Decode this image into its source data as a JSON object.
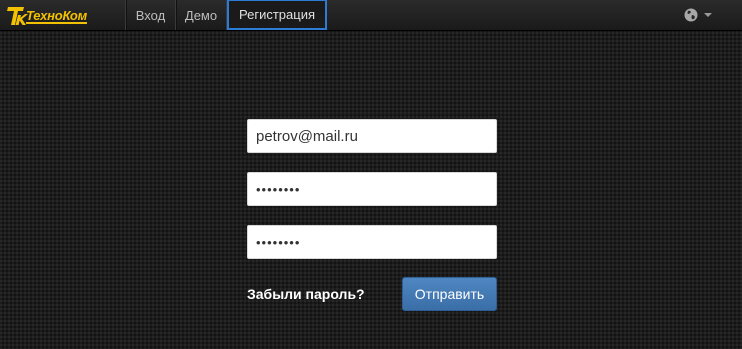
{
  "navbar": {
    "brand_text": "ТехноКом",
    "items": [
      {
        "label": "Вход"
      },
      {
        "label": "Демо"
      },
      {
        "label": "Регистрация",
        "active": true
      }
    ],
    "language_icon": "globe-icon"
  },
  "form": {
    "email_value": "petrov@mail.ru",
    "password_value": "••••••••",
    "password_confirm_value": "••••••••",
    "forgot_label": "Забыли пароль?",
    "submit_label": "Отправить"
  },
  "colors": {
    "brand": "#f2c200",
    "active_tab_border": "#2d7bd4",
    "submit_button": "#4a80bb",
    "background": "#1c1c1c"
  }
}
